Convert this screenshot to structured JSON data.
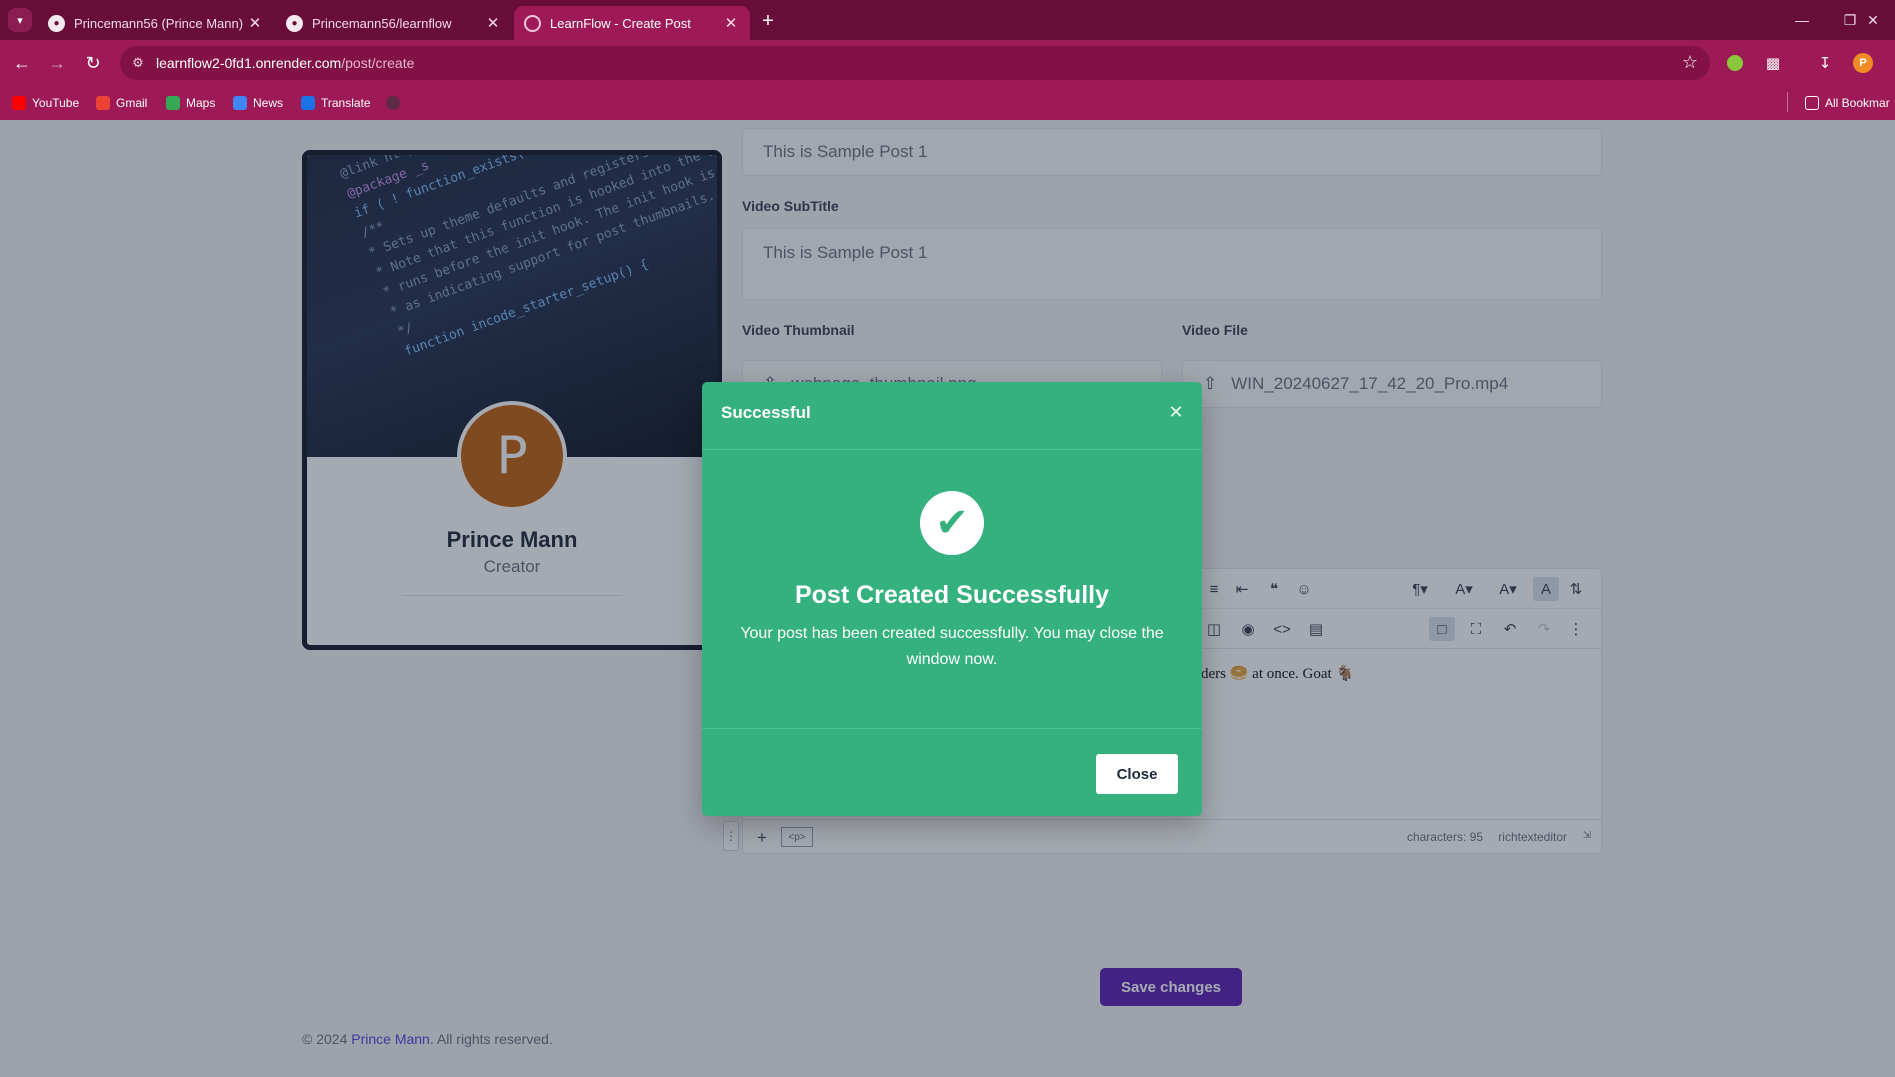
{
  "browser": {
    "tabs": [
      {
        "label": "Princemann56 (Prince Mann)",
        "icon": "github-icon"
      },
      {
        "label": "Princemann56/learnflow",
        "icon": "github-icon"
      },
      {
        "label": "LearnFlow - Create Post",
        "icon": "loading-icon"
      }
    ],
    "address": {
      "host": "learnflow2-0fd1.onrender.com",
      "path": "/post/create"
    },
    "bookmarks": [
      "YouTube",
      "Gmail",
      "Maps",
      "News",
      "Translate"
    ],
    "all_bookmarks": "All Bookmar",
    "profile_initial": "P"
  },
  "profile": {
    "initial": "P",
    "name": "Prince Mann",
    "role": "Creator",
    "cover_code": [
      "@link https://developer.wordpress.org/",
      "@package _s",
      "if ( ! function_exists( 'incode_starter_setup' ) ) :",
      "/**",
      " * Sets up theme defaults and registers support for various WordPress features.",
      " * Note that this function is hooked into the after_setup_theme hook, which",
      " * runs before the init hook. The init hook is too late for some features, such",
      " * as indicating support for post thumbnails.",
      " */",
      "function incode_starter_setup() {"
    ]
  },
  "form": {
    "title_value": "This is Sample Post 1",
    "subtitle_label": "Video SubTitle",
    "subtitle_value": "This is Sample Post 1",
    "thumbnail_label": "Video Thumbnail",
    "thumbnail_value": "webpage_thumbnail.png",
    "file_label": "Video File",
    "file_value": "WIN_20240627_17_42_20_Pro.mp4",
    "save_label": "Save changes"
  },
  "editor": {
    "content_visible": "ders 🥯 at once. Goat 🐐",
    "chars_label": "characters: 95",
    "brand": "richtexteditor",
    "tag": "<p>"
  },
  "modal": {
    "title": "Successful",
    "heading": "Post Created Successfully",
    "body": "Your post has been created successfully. You may close the window now.",
    "close_label": "Close",
    "color": "#34b17f"
  },
  "footer": {
    "prefix": "© 2024 ",
    "link": "Prince Mann",
    "suffix": ". All rights reserved."
  },
  "colors": {
    "browser_frame": "#9d1a57",
    "accent_button": "#5b21b6"
  }
}
